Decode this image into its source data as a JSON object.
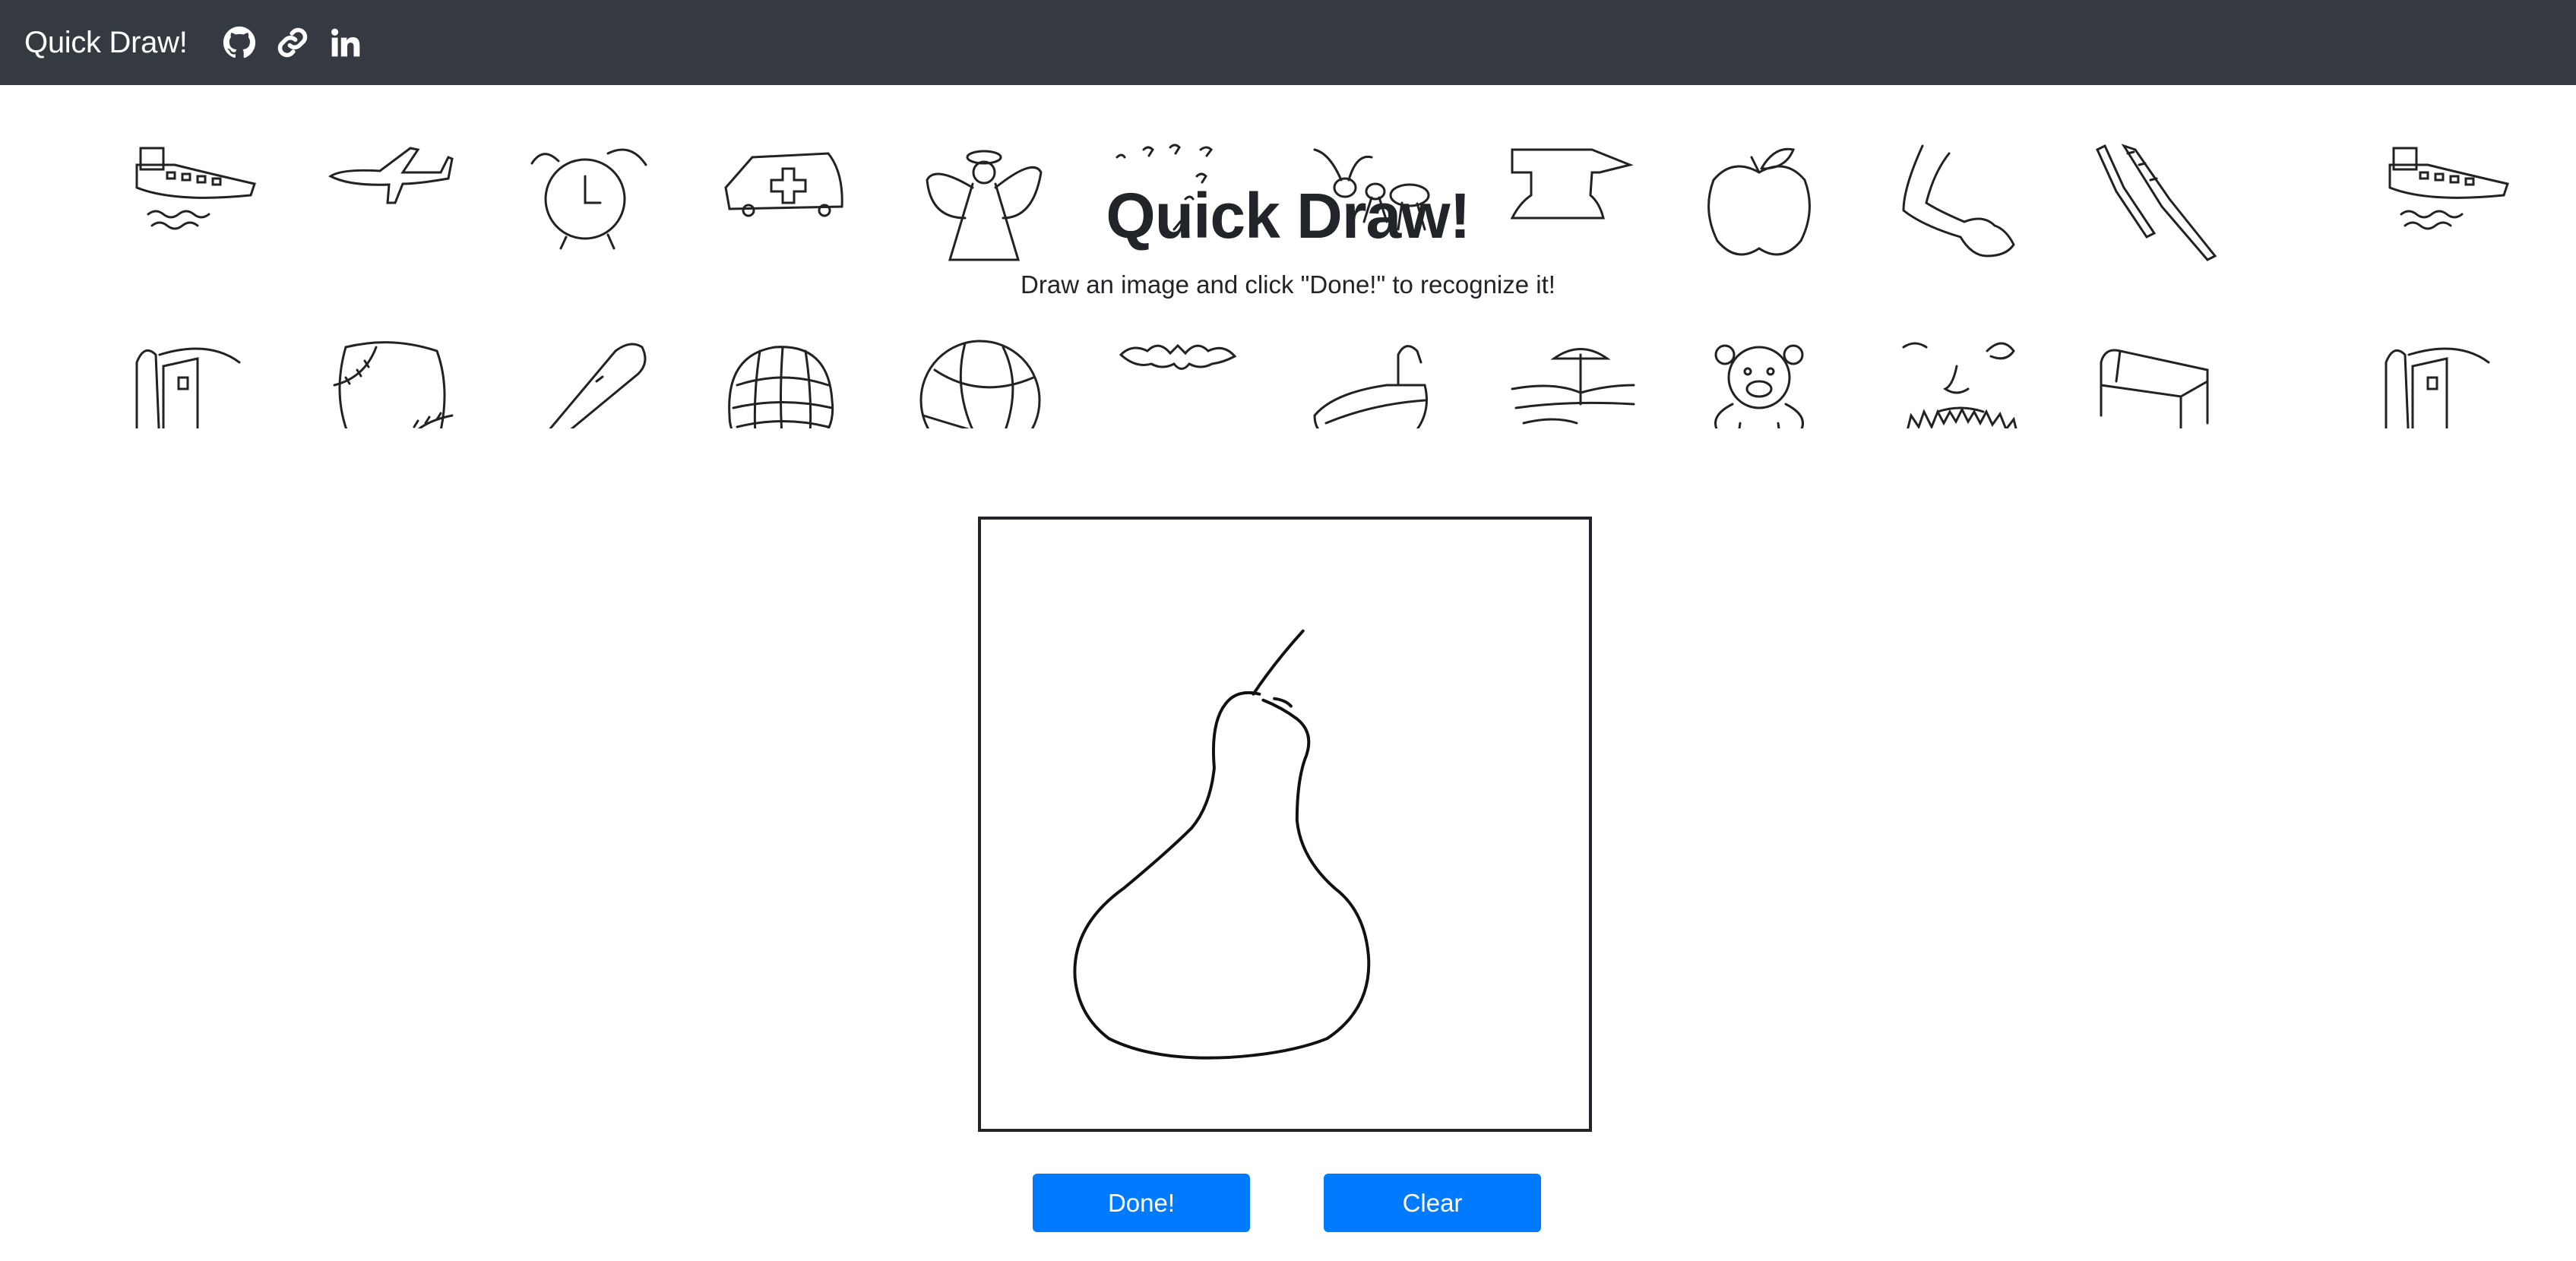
{
  "navbar": {
    "brand": "Quick Draw!",
    "icons": [
      "github-icon",
      "link-icon",
      "linkedin-icon"
    ]
  },
  "banner": {
    "title": "Quick Draw!",
    "subtitle": "Draw an image and click \"Done!\" to recognize it!",
    "row1_doodles": [
      "aircraft-carrier",
      "airplane",
      "alarm-clock",
      "ambulance",
      "angel",
      "animal-migration",
      "ant",
      "anvil",
      "apple",
      "arm",
      "asparagus",
      "aircraft-carrier"
    ],
    "row2_doodles": [
      "barn",
      "baseball",
      "baseball-bat",
      "basket",
      "basketball",
      "bat",
      "bathtub",
      "beach",
      "bear",
      "beard",
      "bed",
      "barn"
    ]
  },
  "canvas": {
    "drawing": "pear"
  },
  "buttons": {
    "done_label": "Done!",
    "clear_label": "Clear"
  },
  "colors": {
    "navbar_bg": "#343a40",
    "button_bg": "#007bff",
    "text": "#212529"
  }
}
